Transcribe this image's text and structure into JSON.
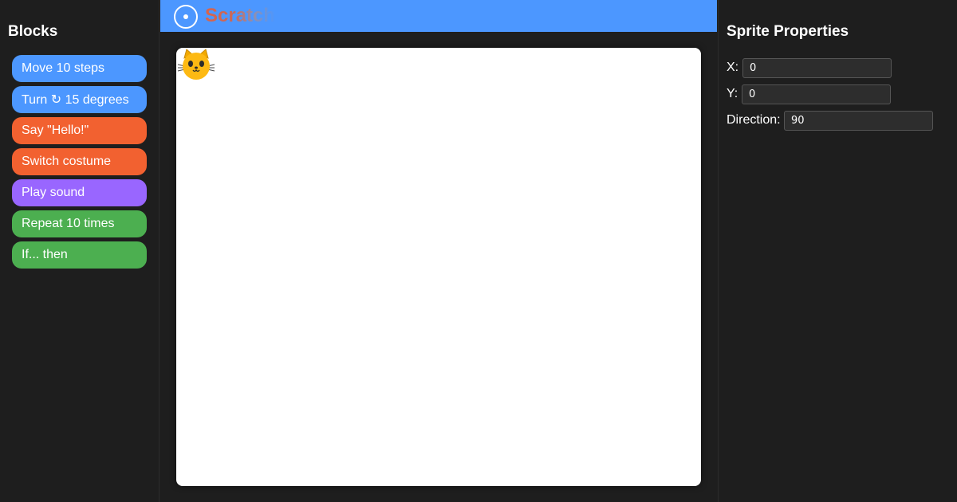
{
  "blocks_panel": {
    "title": "Blocks",
    "items": [
      {
        "label": "Move 10 steps",
        "color": "#4c97ff"
      },
      {
        "label": "Turn ↻ 15 degrees",
        "color": "#4c97ff"
      },
      {
        "label": "Say \"Hello!\"",
        "color": "#f26130"
      },
      {
        "label": "Switch costume",
        "color": "#f26130"
      },
      {
        "label": "Play sound",
        "color": "#9966ff"
      },
      {
        "label": "Repeat 10 times",
        "color": "#4caf50"
      },
      {
        "label": "If... then",
        "color": "#4caf50"
      }
    ]
  },
  "header": {
    "app_name": "Scratch",
    "logo_icon": "target-icon",
    "color": "#4c97ff"
  },
  "stage": {
    "sprite_icon": "cat-face-icon"
  },
  "properties": {
    "title": "Sprite Properties",
    "x_label": "X:",
    "x_value": "0",
    "y_label": "Y:",
    "y_value": "0",
    "direction_label": "Direction:",
    "direction_value": "90"
  }
}
